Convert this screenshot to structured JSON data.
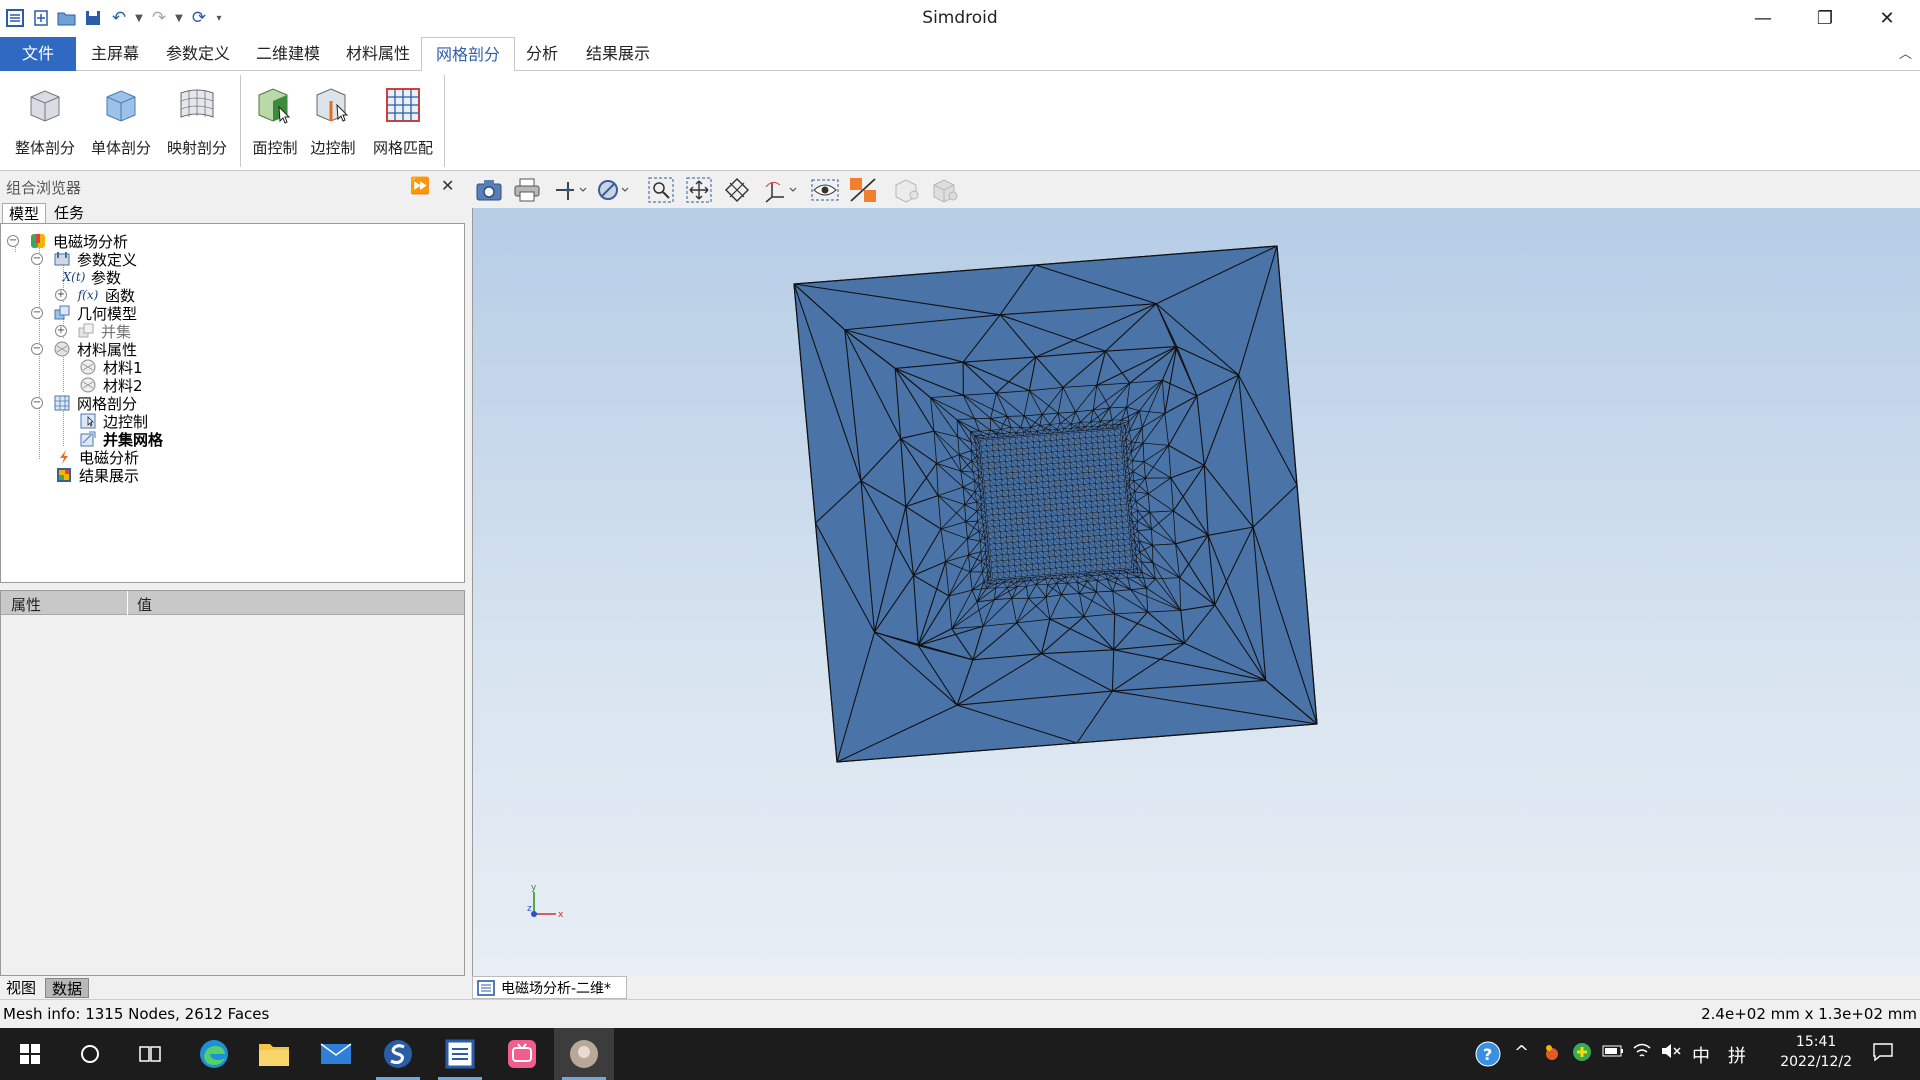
{
  "app": {
    "title": "Simdroid"
  },
  "window_controls": {
    "minimize": "—",
    "restore": "❐",
    "close": "✕"
  },
  "ribbon": {
    "tabs": [
      "文件",
      "主屏幕",
      "参数定义",
      "二维建模",
      "材料属性",
      "网格剖分",
      "分析",
      "结果展示"
    ],
    "active_tab": "网格剖分",
    "buttons": [
      "整体剖分",
      "单体剖分",
      "映射剖分",
      "面控制",
      "边控制",
      "网格匹配"
    ]
  },
  "combo_browser": {
    "title": "组合浏览器",
    "tabs": [
      "模型",
      "任务"
    ],
    "tree": [
      {
        "label": "电磁场分析",
        "level": 0,
        "expander": "−",
        "icon": "electromagnetic-analysis-icon"
      },
      {
        "label": "参数定义",
        "level": 1,
        "expander": "−",
        "icon": "parameter-definition-icon"
      },
      {
        "label": "参数",
        "level": 2,
        "expander": "",
        "icon": "variable-icon",
        "icon_text": "X(t)"
      },
      {
        "label": "函数",
        "level": 2,
        "expander": "+",
        "icon": "function-icon",
        "icon_text": "f(x)"
      },
      {
        "label": "几何模型",
        "level": 1,
        "expander": "−",
        "icon": "geometry-model-icon"
      },
      {
        "label": "并集",
        "level": 2,
        "expander": "+",
        "icon": "union-icon",
        "muted": true
      },
      {
        "label": "材料属性",
        "level": 1,
        "expander": "−",
        "icon": "material-icon"
      },
      {
        "label": "材料1",
        "level": 2,
        "expander": "",
        "icon": "material-icon"
      },
      {
        "label": "材料2",
        "level": 2,
        "expander": "",
        "icon": "material-icon"
      },
      {
        "label": "网格剖分",
        "level": 1,
        "expander": "−",
        "icon": "mesh-icon"
      },
      {
        "label": "边控制",
        "level": 2,
        "expander": "",
        "icon": "edge-control-icon"
      },
      {
        "label": "并集网格",
        "level": 2,
        "expander": "",
        "icon": "union-mesh-icon",
        "bold": true
      },
      {
        "label": "电磁分析",
        "level": 1,
        "expander": "",
        "icon": "em-solver-icon"
      },
      {
        "label": "结果展示",
        "level": 1,
        "expander": "",
        "icon": "result-display-icon"
      }
    ]
  },
  "properties": {
    "col_property": "属性",
    "col_value": "值"
  },
  "bottom_tabs": [
    "视图",
    "数据"
  ],
  "active_bottom_tab": "数据",
  "document_tab": {
    "label": "电磁场分析-二维*"
  },
  "axis_triad": {
    "x": "x",
    "y": "y",
    "z": "z"
  },
  "status": {
    "mesh_info": "Mesh info: 1315 Nodes, 2612 Faces",
    "dimensions": "2.4e+02 mm x 1.3e+02 mm"
  },
  "tray": {
    "ime_lang": "中",
    "ime_mode": "拼",
    "time": "15:41",
    "date": "2022/12/2"
  },
  "colors": {
    "file_tab": "#2f69c2",
    "mesh_fill": "#4a74a8",
    "mesh_edge": "#111111",
    "viewport_top": "#b6cde6",
    "viewport_bottom": "#e8eef4",
    "taskbar": "#1c1c1c"
  }
}
